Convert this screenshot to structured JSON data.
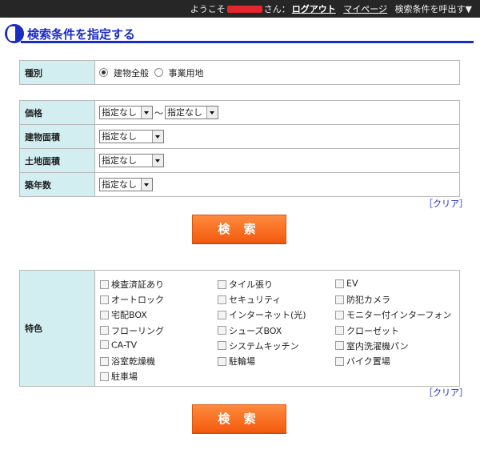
{
  "topbar": {
    "welcome": "ようこそ",
    "suffix": "さん：",
    "logout": "ログアウト",
    "mypage": "マイページ",
    "recall": "検索条件を呼出す▼"
  },
  "page_title": "検索条件を指定する",
  "type_section": {
    "label": "種別",
    "options": [
      "建物全般",
      "事業用地"
    ],
    "selected": "建物全般"
  },
  "conditions": {
    "price": {
      "label": "価格",
      "from": "指定なし",
      "to": "指定なし",
      "separator": "～"
    },
    "building_area": {
      "label": "建物面積",
      "value": "指定なし"
    },
    "land_area": {
      "label": "土地面積",
      "value": "指定なし"
    },
    "age": {
      "label": "築年数",
      "value": "指定なし"
    }
  },
  "clear": {
    "open": "［",
    "label": "クリア",
    "close": "］"
  },
  "search_button": "検 索",
  "features": {
    "label": "特色",
    "items": [
      "検査済証あり",
      "タイル張り",
      "EV",
      "オートロック",
      "セキュリティ",
      "防犯カメラ",
      "宅配BOX",
      "インターネット(光)",
      "モニター付インターフォン",
      "フローリング",
      "シューズBOX",
      "クローゼット",
      "CA-TV",
      "システムキッチン",
      "室内洗濯機パン",
      "浴室乾燥機",
      "駐輪場",
      "バイク置場",
      "駐車場"
    ]
  }
}
